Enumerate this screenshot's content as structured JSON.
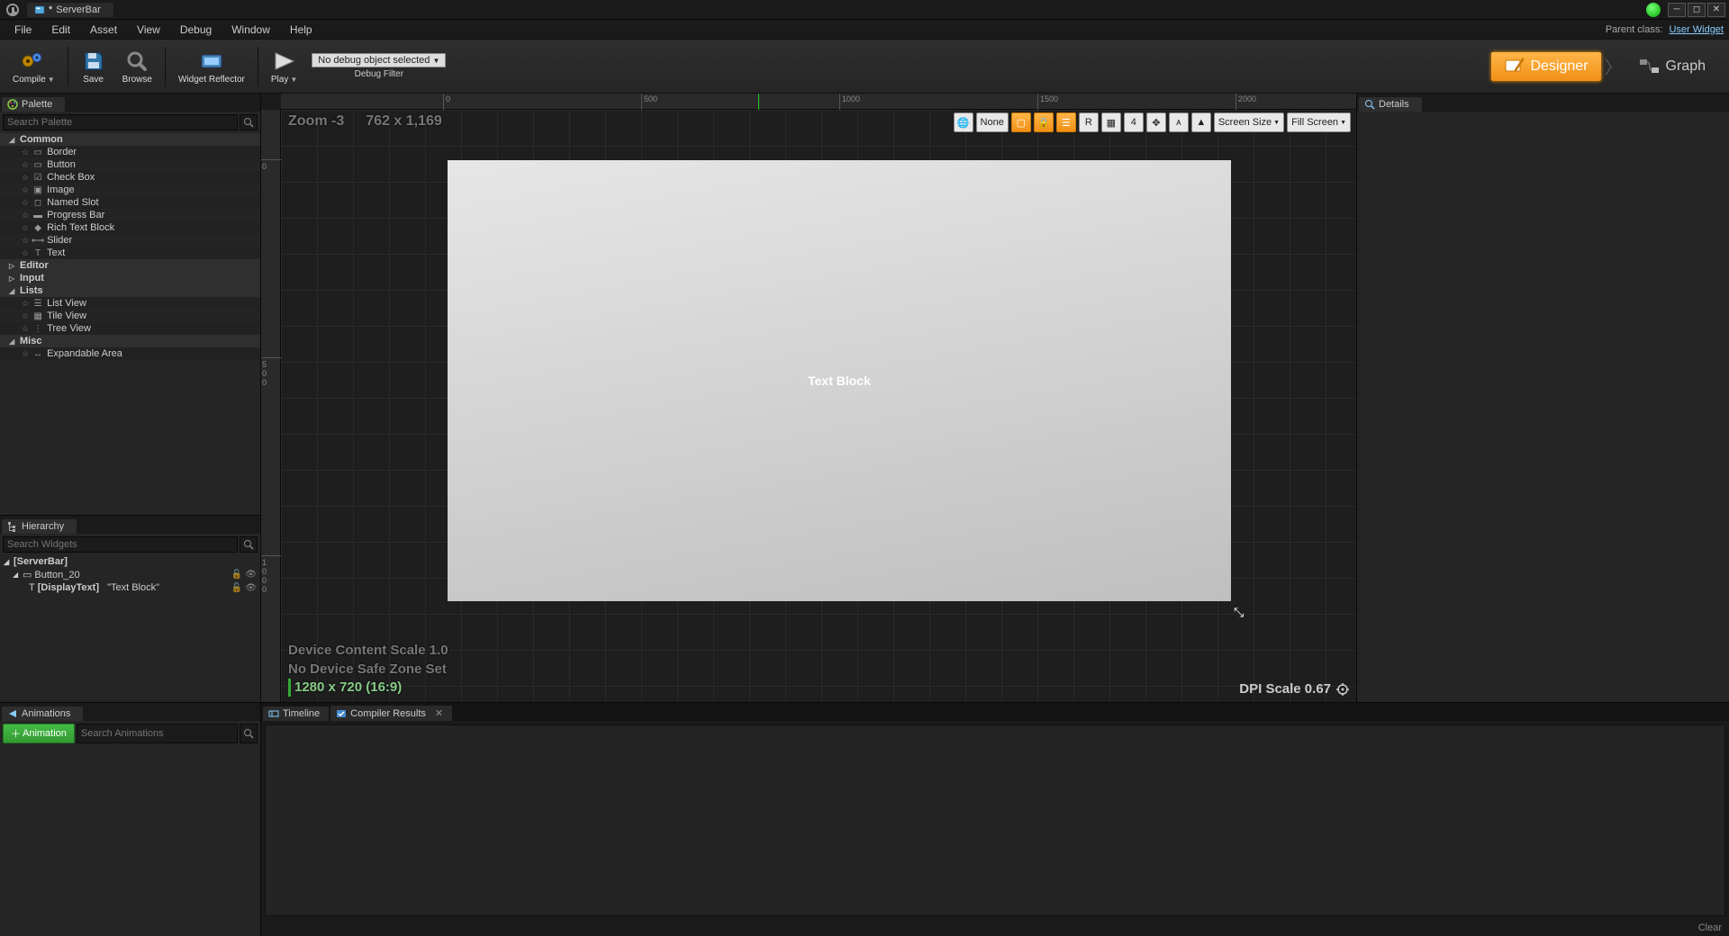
{
  "titlebar": {
    "tab_name": "ServerBar",
    "tab_dirty": "*"
  },
  "menubar": {
    "items": [
      "File",
      "Edit",
      "Asset",
      "View",
      "Debug",
      "Window",
      "Help"
    ],
    "parent_class_label": "Parent class:",
    "parent_class_value": "User Widget"
  },
  "toolbar": {
    "compile": "Compile",
    "save": "Save",
    "browse": "Browse",
    "widget_reflector": "Widget Reflector",
    "play": "Play",
    "debug_selected": "No debug object selected",
    "debug_filter": "Debug Filter",
    "designer": "Designer",
    "graph": "Graph"
  },
  "palette": {
    "title": "Palette",
    "search_placeholder": "Search Palette",
    "groups": [
      {
        "name": "Common",
        "expanded": true,
        "items": [
          "Border",
          "Button",
          "Check Box",
          "Image",
          "Named Slot",
          "Progress Bar",
          "Rich Text Block",
          "Slider",
          "Text"
        ]
      },
      {
        "name": "Editor",
        "expanded": false,
        "items": []
      },
      {
        "name": "Input",
        "expanded": false,
        "items": []
      },
      {
        "name": "Lists",
        "expanded": true,
        "items": [
          "List View",
          "Tile View",
          "Tree View"
        ]
      },
      {
        "name": "Misc",
        "expanded": true,
        "items": [
          "Expandable Area"
        ]
      }
    ]
  },
  "hierarchy": {
    "title": "Hierarchy",
    "search_placeholder": "Search Widgets",
    "root": "[ServerBar]",
    "child1": "Button_20",
    "child2_pre": "[DisplayText]",
    "child2_post": "\"Text Block\""
  },
  "details": {
    "title": "Details"
  },
  "viewport": {
    "zoom": "Zoom -3",
    "size_cursor": "762 x 1,169",
    "ruler_h": [
      {
        "pos": 180,
        "label": "0"
      },
      {
        "pos": 400,
        "label": "500"
      },
      {
        "pos": 620,
        "label": "1000"
      },
      {
        "pos": 840,
        "label": "1500"
      },
      {
        "pos": 1060,
        "label": "2000"
      }
    ],
    "ruler_v": [
      {
        "pos": 55,
        "label": "0"
      },
      {
        "pos": 275,
        "label": "500"
      },
      {
        "pos": 495,
        "label": "1000"
      }
    ],
    "toolbar": {
      "none": "None",
      "four": "4",
      "r": "R",
      "screen_size": "Screen Size",
      "fill_screen": "Fill Screen"
    },
    "textblock": "Text Block",
    "bl1": "Device Content Scale 1.0",
    "bl2": "No Device Safe Zone Set",
    "bl3": "1280 x 720 (16:9)",
    "dpi": "DPI Scale 0.67"
  },
  "animations": {
    "title": "Animations",
    "add": "Animation",
    "search_placeholder": "Search Animations"
  },
  "bottom_tabs": {
    "timeline": "Timeline",
    "compiler": "Compiler Results",
    "clear": "Clear"
  }
}
